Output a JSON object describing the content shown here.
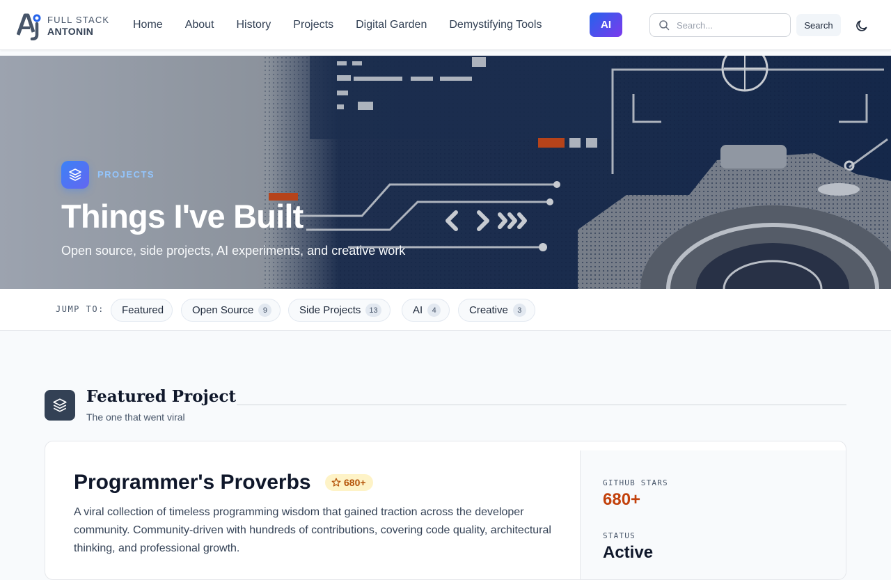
{
  "header": {
    "logo": {
      "line1": "FULL STACK",
      "line2": "ANTONIN",
      "mark": "Aj"
    },
    "nav": [
      {
        "label": "Home"
      },
      {
        "label": "About"
      },
      {
        "label": "History"
      },
      {
        "label": "Projects"
      },
      {
        "label": "Digital Garden"
      },
      {
        "label": "Demystifying Tools"
      }
    ],
    "ai_label": "AI",
    "search": {
      "placeholder": "Search...",
      "button_label": "Search",
      "icon": "search-icon"
    },
    "theme_icon": "moon-icon"
  },
  "hero": {
    "eyebrow": "PROJECTS",
    "icon": "layers-icon",
    "title": "Things I've Built",
    "subtitle": "Open source, side projects, AI experiments, and creative work"
  },
  "jump": {
    "label": "JUMP TO:",
    "items": [
      {
        "label": "Featured",
        "count": null
      },
      {
        "label": "Open Source",
        "count": "9"
      },
      {
        "label": "Side Projects",
        "count": "13"
      },
      {
        "label": "AI",
        "count": "4"
      },
      {
        "label": "Creative",
        "count": "3"
      }
    ]
  },
  "section": {
    "icon": "layers-icon",
    "title": "Featured Project",
    "subtitle": "The one that went viral"
  },
  "featured": {
    "title": "Programmer's Proverbs",
    "stars_badge": "680+",
    "description": "A viral collection of timeless programming wisdom that gained traction across the developer community. Community-driven with hundreds of contributions, covering code quality, architectural thinking, and professional growth.",
    "stats": [
      {
        "label": "GITHUB STARS",
        "value": "680+",
        "color": "#c2410c"
      },
      {
        "label": "STATUS",
        "value": "Active",
        "color": "#0f172a"
      }
    ]
  },
  "colors": {
    "accent": "#2563eb",
    "ai_gradient_end": "#7c3aed",
    "eyebrow": "#93c5fd",
    "star_badge_bg": "#fef3c7",
    "star_badge_text": "#b45309"
  }
}
